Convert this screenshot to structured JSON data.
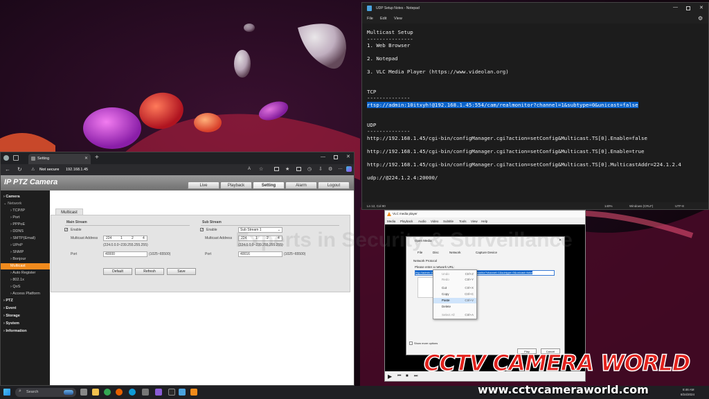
{
  "colors": {
    "accent_orange": "#f08a1d",
    "selection_blue": "#0a62c9",
    "watermark_red": "#e3211c"
  },
  "browser": {
    "tab_title": "Setting",
    "security_label": "Not secure",
    "url": "192.168.1.45",
    "camera": {
      "title": "IP PTZ Camera",
      "nav_tabs": [
        "Live",
        "Playback",
        "Setting",
        "Alarm",
        "Logout"
      ],
      "active_tab": "Setting",
      "sidebar": [
        {
          "label": "Camera",
          "level": 0
        },
        {
          "label": "Network",
          "level": 0
        },
        {
          "label": "TCP/IP",
          "level": 1
        },
        {
          "label": "Port",
          "level": 1
        },
        {
          "label": "PPPoE",
          "level": 1
        },
        {
          "label": "DDNS",
          "level": 1
        },
        {
          "label": "SMTP(Email)",
          "level": 1
        },
        {
          "label": "UPnP",
          "level": 1
        },
        {
          "label": "SNMP",
          "level": 1
        },
        {
          "label": "Bonjour",
          "level": 1
        },
        {
          "label": "Multicast",
          "level": 1,
          "active": true
        },
        {
          "label": "Auto Register",
          "level": 1
        },
        {
          "label": "802.1x",
          "level": 1
        },
        {
          "label": "QoS",
          "level": 1
        },
        {
          "label": "Access Platform",
          "level": 1
        },
        {
          "label": "PTZ",
          "level": 0
        },
        {
          "label": "Event",
          "level": 0
        },
        {
          "label": "Storage",
          "level": 0
        },
        {
          "label": "System",
          "level": 0
        },
        {
          "label": "Information",
          "level": 0
        }
      ],
      "multicast": {
        "tab_label": "Multicast",
        "main_stream": {
          "heading": "Main Stream",
          "enable_label": "Enable",
          "address_label": "Multicast Address",
          "address": [
            "224",
            "1",
            "2",
            "4"
          ],
          "address_range": "(224.0.0.0~239.255.255.255)",
          "port_label": "Port",
          "port": "40000",
          "port_range": "(1025~65500)"
        },
        "sub_stream": {
          "heading": "Sub Stream",
          "enable_label": "Enable",
          "select_value": "Sub Stream 1",
          "address_label": "Multicast Address",
          "address": [
            "224",
            "1",
            "2",
            "4"
          ],
          "address_range": "(224.0.0.0~239.255.255.255)",
          "port_label": "Port",
          "port": "40016",
          "port_range": "(1025~65500)"
        },
        "buttons": [
          "Default",
          "Refresh",
          "Save"
        ]
      }
    }
  },
  "notepad": {
    "title": "UDP Setup Notes - Notepad",
    "menu": [
      "File",
      "Edit",
      "View"
    ],
    "lines": [
      "Multicast Setup",
      "---------------",
      "1. Web Browser",
      "",
      "2. Notepad",
      "",
      "3. VLC Media Player (https://www.videolan.org)",
      "",
      "TCP",
      "--------------",
      "rtsp://admin:10itxyh!@192.168.1.45:554/cam/realmonitor?channel=1&subtype=0&unicast=false",
      "",
      "UDP",
      "--------------",
      "http://192.168.1.45/cgi-bin/configManager.cgi?action=setConfig&Multicast.TS[0].Enable=false",
      "",
      "http://192.168.1.45/cgi-bin/configManager.cgi?action=setConfig&Multicast.TS[0].Enable=true",
      "",
      "http://192.168.1.45/cgi-bin/configManager.cgi?action=setConfig&Multicast.TS[0].MulticastAddr=224.1.2.4",
      "",
      "udp://@224.1.2.4:20000/"
    ],
    "status": {
      "position": "Ln 12, Col 90",
      "zoom": "140%",
      "line_ending": "Windows (CRLF)",
      "encoding": "UTF-8"
    }
  },
  "vlc": {
    "title": "VLC media player",
    "menu": [
      "Media",
      "Playback",
      "Audio",
      "Video",
      "Subtitle",
      "Tools",
      "View",
      "Help"
    ],
    "dialog": {
      "title": "Open Media",
      "tabs": [
        "File",
        "Disc",
        "Network",
        "Capture Device"
      ],
      "section": "Network Protocol",
      "prompt": "Please enter a network URL:",
      "url_value": "rtsp://admin:10itxyh!@192.168.1.45:554/cam/realmonitor?channel=1&subtype=0&unicast=false",
      "show_more": "Show more options",
      "play_label": "Play",
      "cancel_label": "Cancel"
    },
    "context_menu": [
      {
        "label": "Undo",
        "key": "Ctrl+Z",
        "enabled": false
      },
      {
        "label": "Redo",
        "key": "Ctrl+Y",
        "enabled": false
      },
      {
        "label": "Cut",
        "key": "Ctrl+X",
        "enabled": true
      },
      {
        "label": "Copy",
        "key": "Ctrl+C",
        "enabled": true
      },
      {
        "label": "Paste",
        "key": "Ctrl+V",
        "enabled": true,
        "highlighted": true
      },
      {
        "label": "Delete",
        "key": "",
        "enabled": true
      },
      {
        "label": "Select All",
        "key": "Ctrl+A",
        "enabled": false
      }
    ]
  },
  "taskbar": {
    "search_placeholder": "Search",
    "time": "8:46 AM",
    "date": "8/24/2024"
  },
  "watermark": {
    "logo_text": "CCTV CAMERA WORLD",
    "url": "www.cctvcameraworld.com",
    "faint_text": "Experts in Security & Surveillance"
  }
}
